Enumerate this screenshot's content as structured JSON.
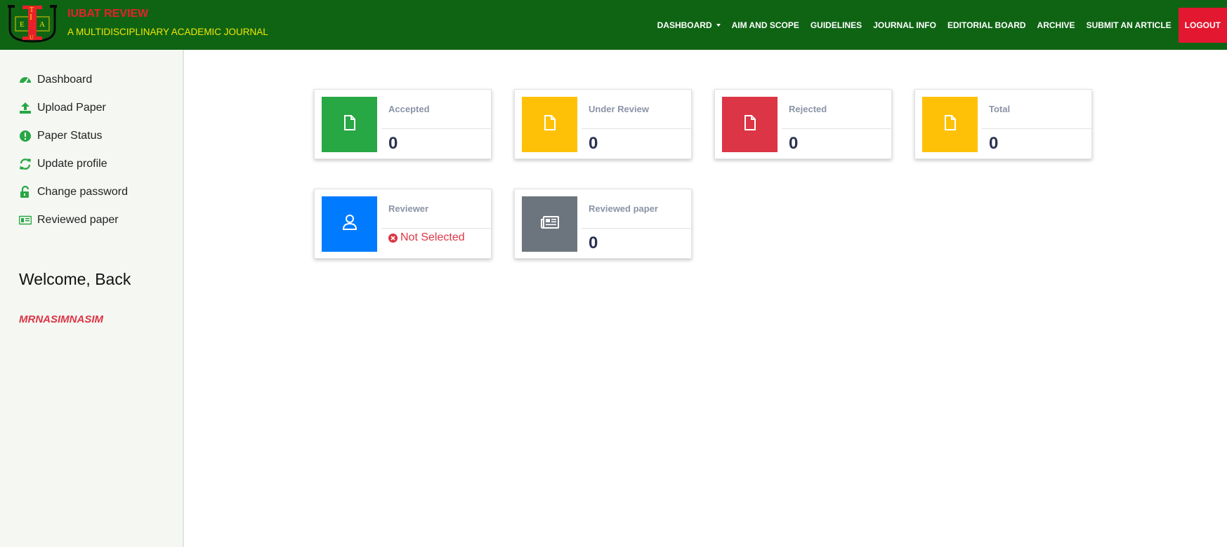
{
  "brand": {
    "logo_letters": [
      "E",
      "I",
      "T",
      "A",
      "U"
    ],
    "title": "IUBAT REVIEW",
    "subtitle": "A MULTIDISCIPLINARY ACADEMIC JOURNAL"
  },
  "nav": {
    "items": [
      "DASHBOARD",
      "AIM AND SCOPE",
      "GUIDELINES",
      "JOURNAL INFO",
      "EDITORIAL BOARD",
      "ARCHIVE",
      "SUBMIT AN ARTICLE"
    ],
    "logout": "LOGOUT"
  },
  "sidebar": {
    "items": [
      {
        "label": "Dashboard",
        "icon": "tachometer-icon"
      },
      {
        "label": "Upload Paper",
        "icon": "upload-icon"
      },
      {
        "label": "Paper Status",
        "icon": "exclamation-circle-icon"
      },
      {
        "label": "Update profile",
        "icon": "refresh-icon"
      },
      {
        "label": "Change password",
        "icon": "unlock-icon"
      },
      {
        "label": "Reviewed paper",
        "icon": "id-card-icon"
      }
    ],
    "welcome": "Welcome, Back",
    "username": "MRNASIMNASIM"
  },
  "cards": [
    {
      "label": "Accepted",
      "value": "0",
      "color": "#28a745",
      "icon": "file-icon"
    },
    {
      "label": "Under Review",
      "value": "0",
      "color": "#ffc107",
      "icon": "file-icon"
    },
    {
      "label": "Rejected",
      "value": "0",
      "color": "#dc3545",
      "icon": "file-icon"
    },
    {
      "label": "Total",
      "value": "0",
      "color": "#ffc107",
      "icon": "file-icon"
    },
    {
      "label": "Reviewer",
      "status": "Not Selected",
      "color": "#007bff",
      "icon": "user-icon"
    },
    {
      "label": "Reviewed paper",
      "value": "0",
      "color": "#6c757d",
      "icon": "newspaper-icon"
    }
  ],
  "colors": {
    "navbar": "#0f6414",
    "brand_title": "#e8202a",
    "brand_subtitle": "#f2e600",
    "logout": "#e3172f",
    "sidebar_icon": "#28a745",
    "username": "#dc3545"
  }
}
